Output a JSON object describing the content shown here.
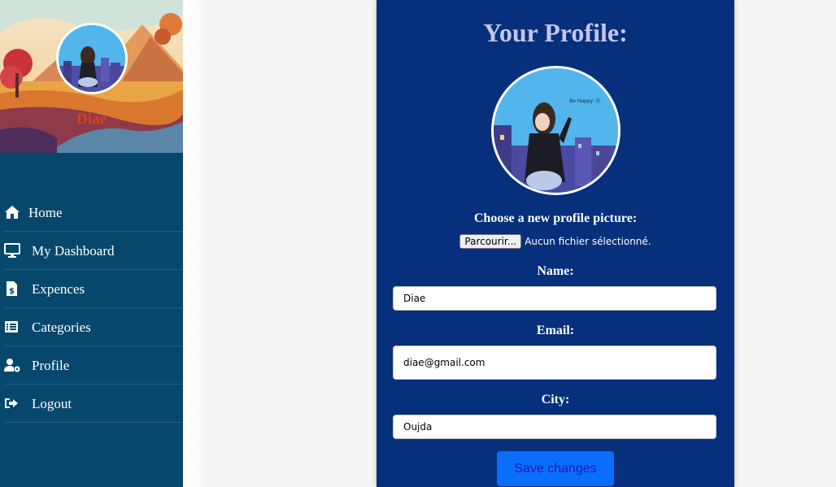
{
  "sidebar": {
    "user_name": "Diae",
    "items": [
      {
        "label": "Home",
        "icon": "home-icon"
      },
      {
        "label": "My Dashboard",
        "icon": "monitor-icon"
      },
      {
        "label": "Expences",
        "icon": "invoice-dollar-icon"
      },
      {
        "label": "Categories",
        "icon": "list-icon"
      },
      {
        "label": "Profile",
        "icon": "user-gear-icon"
      },
      {
        "label": "Logout",
        "icon": "logout-icon"
      }
    ]
  },
  "profile": {
    "title": "Your Profile:",
    "picture_label": "Choose a new profile picture:",
    "file_button": "Parcourir...",
    "file_status": "Aucun fichier sélectionné.",
    "picture_caption": "Be Happy :))",
    "name_label": "Name:",
    "name_value": "Diae",
    "email_label": "Email:",
    "email_value": "diae@gmail.com",
    "city_label": "City:",
    "city_value": "Oujda",
    "save_label": "Save changes"
  },
  "colors": {
    "sidebar_bg": "#07476c",
    "card_bg": "#062f7c",
    "title_color": "#c3c6e6",
    "accent_button": "#0a6efb",
    "button_text": "#1d1ab8",
    "banner_name_color": "#d9411f"
  }
}
